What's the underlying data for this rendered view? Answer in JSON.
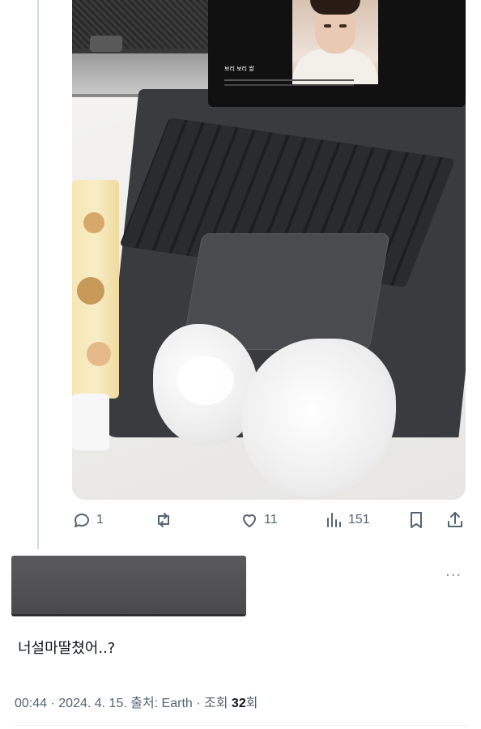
{
  "tweet": {
    "reply_count": "1",
    "retweet_count": "",
    "like_count": "11",
    "view_count": "151"
  },
  "reply": {
    "more_label": "···",
    "text": "너설마딸쳤어..?",
    "meta": {
      "time": "00:44",
      "sep1": " · ",
      "date": "2024. 4. 15.",
      "source_label": " 출처: Earth",
      "sep2": " · ",
      "views_prefix": "조회 ",
      "views_count": "32",
      "views_suffix": "회"
    }
  },
  "screen": {
    "title": "보리 보리 쌀"
  },
  "icons": [
    "reply-icon",
    "retweet-icon",
    "like-icon",
    "views-icon",
    "bookmark-icon",
    "share-icon",
    "more-icon"
  ],
  "colors": {
    "icon_gray": "#536471",
    "text": "#0f1419",
    "thread_line": "#cfd9de"
  }
}
